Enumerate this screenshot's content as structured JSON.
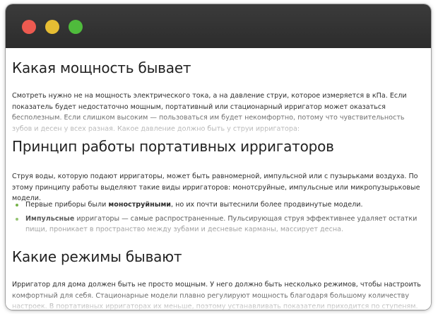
{
  "window": {
    "controls": {
      "close_color": "#ed5a50",
      "minimize_color": "#e6bd33",
      "maximize_color": "#4fbb3c"
    }
  },
  "article": {
    "section1": {
      "title": "Какая мощность бывает",
      "text": "Смотреть нужно не на мощность электрического тока, а на давление струи, которое измеряется в кПа. Если показатель будет недостаточно мощным, портативный или стационарный ирригатор может оказаться бесполезным. Если слишком высоким — пользоваться им будет некомфортно, потому что чувствительность зубов и десен у всех разная. Какое давление должно быть у струи ирригатора:"
    },
    "section2": {
      "title": "Принцип работы портативных ирригаторов",
      "text": "Струя воды, которую подают ирригаторы, может быть равномерной, импульсной или с пузырьками воздуха. По этому принципу работы выделяют такие виды ирригаторов: монотсруйные, импульсные или микропузырьковые модели.",
      "bullets": [
        {
          "before": "Первые приборы были ",
          "bold": "моноструйными",
          "after": ", но их почти вытеснили более продвинутые модели."
        },
        {
          "before": "",
          "bold": "Импульсные",
          "after": " ирригаторы — самые распространенные. Пульсирующая струя эффективнее удаляет остатки пищи, проникает в пространство между зубами и десневые карманы, массирует десна."
        }
      ],
      "bullet_color": "#76b34a"
    },
    "section3": {
      "title": "Какие режимы бывают",
      "text": "Ирригатор для дома должен быть не просто мощным. У него должно быть несколько режимов, чтобы настроить комфортный для себя. Стационарные модели плавно регулируют мощность благодаря большому количеству настроек. В портативных ирригаторах их меньше, поэтому устанавливать показатели приходится по ступеням."
    }
  }
}
